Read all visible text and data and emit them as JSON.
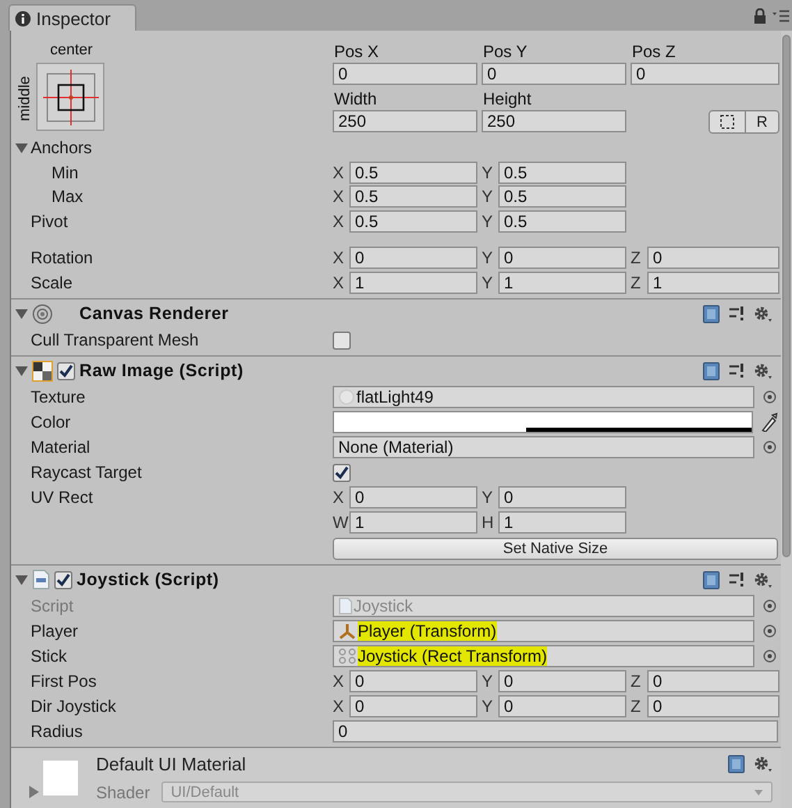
{
  "tab": {
    "title": "Inspector"
  },
  "rect_transform": {
    "anchor_preset": {
      "horizontal": "center",
      "vertical": "middle"
    },
    "position_fields": [
      {
        "label": "Pos X",
        "value": "0"
      },
      {
        "label": "Pos Y",
        "value": "0"
      },
      {
        "label": "Pos Z",
        "value": "0"
      }
    ],
    "size_fields": [
      {
        "label": "Width",
        "value": "250"
      },
      {
        "label": "Height",
        "value": "250"
      }
    ],
    "raw_button": "R",
    "anchors": {
      "label": "Anchors",
      "expanded": true,
      "rows": [
        {
          "label": "Min",
          "axes": [
            {
              "axis": "X",
              "value": "0.5"
            },
            {
              "axis": "Y",
              "value": "0.5"
            }
          ]
        },
        {
          "label": "Max",
          "axes": [
            {
              "axis": "X",
              "value": "0.5"
            },
            {
              "axis": "Y",
              "value": "0.5"
            }
          ]
        }
      ]
    },
    "pivot": {
      "label": "Pivot",
      "axes": [
        {
          "axis": "X",
          "value": "0.5"
        },
        {
          "axis": "Y",
          "value": "0.5"
        }
      ]
    },
    "transform_rows": [
      {
        "label": "Rotation",
        "axes": [
          {
            "axis": "X",
            "value": "0"
          },
          {
            "axis": "Y",
            "value": "0"
          },
          {
            "axis": "Z",
            "value": "0"
          }
        ]
      },
      {
        "label": "Scale",
        "axes": [
          {
            "axis": "X",
            "value": "1"
          },
          {
            "axis": "Y",
            "value": "1"
          },
          {
            "axis": "Z",
            "value": "1"
          }
        ]
      }
    ]
  },
  "components": [
    {
      "title": "Canvas Renderer",
      "expanded": true,
      "rows": [
        {
          "kind": "check",
          "label": "Cull Transparent Mesh",
          "checked": false
        }
      ]
    },
    {
      "title": "Raw Image (Script)",
      "expanded": true,
      "enabled": true,
      "rows": [
        {
          "kind": "object",
          "label": "Texture",
          "value": "flatLight49",
          "disabled": false,
          "highlighted": false
        },
        {
          "kind": "color",
          "label": "Color"
        },
        {
          "kind": "object",
          "label": "Material",
          "value": "None (Material)",
          "disabled": false,
          "highlighted": false
        },
        {
          "kind": "check",
          "label": "Raycast Target",
          "checked": true
        },
        {
          "kind": "vector",
          "label": "UV Rect",
          "axes": [
            {
              "axis": "X",
              "value": "0"
            },
            {
              "axis": "Y",
              "value": "0"
            }
          ]
        },
        {
          "kind": "vector",
          "axes": [
            {
              "axis": "W",
              "value": "1"
            },
            {
              "axis": "H",
              "value": "1"
            }
          ]
        },
        {
          "kind": "button",
          "label": "Set Native Size"
        }
      ]
    },
    {
      "title": "Joystick (Script)",
      "expanded": true,
      "enabled": true,
      "rows": [
        {
          "kind": "object",
          "label": "Script",
          "value": "Joystick",
          "disabled": true,
          "highlighted": false
        },
        {
          "kind": "object",
          "label": "Player",
          "value": "Player (Transform)",
          "disabled": false,
          "highlighted": true
        },
        {
          "kind": "object",
          "label": "Stick",
          "value": "Joystick (Rect Transform)",
          "disabled": false,
          "highlighted": true
        },
        {
          "kind": "vector",
          "label": "First Pos",
          "axes": [
            {
              "axis": "X",
              "value": "0"
            },
            {
              "axis": "Y",
              "value": "0"
            },
            {
              "axis": "Z",
              "value": "0"
            }
          ]
        },
        {
          "kind": "vector",
          "label": "Dir Joystick",
          "axes": [
            {
              "axis": "X",
              "value": "0"
            },
            {
              "axis": "Y",
              "value": "0"
            },
            {
              "axis": "Z",
              "value": "0"
            }
          ]
        },
        {
          "kind": "text",
          "label": "Radius",
          "value": "0"
        }
      ]
    }
  ],
  "material": {
    "name": "Default UI Material",
    "expanded": false,
    "shader_label": "Shader",
    "shader": "UI/Default"
  }
}
